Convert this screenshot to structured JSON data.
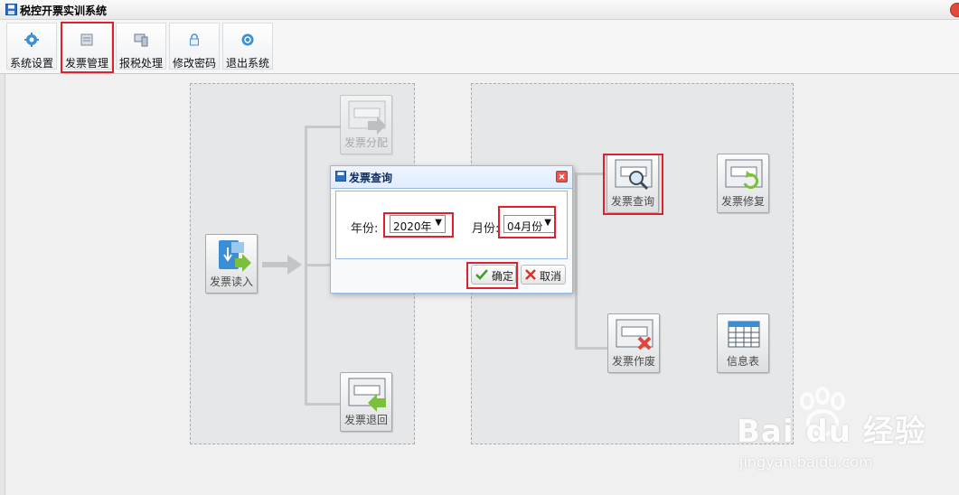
{
  "window": {
    "title": "税控开票实训系统"
  },
  "toolbar": {
    "items": [
      {
        "label": "系统设置",
        "icon": "gear-icon"
      },
      {
        "label": "发票管理",
        "icon": "invoice-manage-icon"
      },
      {
        "label": "报税处理",
        "icon": "computer-icon"
      },
      {
        "label": "修改密码",
        "icon": "lock-icon"
      },
      {
        "label": "退出系统",
        "icon": "power-icon"
      }
    ],
    "highlighted": "发票管理"
  },
  "workflow": {
    "left": {
      "read": "发票读入",
      "distribute": "发票分配",
      "return": "发票退回"
    },
    "right": {
      "query": "发票查询",
      "repair": "发票修复",
      "void": "发票作废",
      "info": "信息表"
    }
  },
  "dialog": {
    "title": "发票查询",
    "year_label": "年份:",
    "year_value": "2020年",
    "month_label": "月份:",
    "month_value": "04月份",
    "ok_label": "确定",
    "cancel_label": "取消"
  },
  "watermark": {
    "brand": "Bai du 经验",
    "domain": "jingyan.baidu.com"
  },
  "colors": {
    "highlight": "#e0202a",
    "dialog_border": "#95b8e7",
    "panel": "#e6e7e8"
  }
}
